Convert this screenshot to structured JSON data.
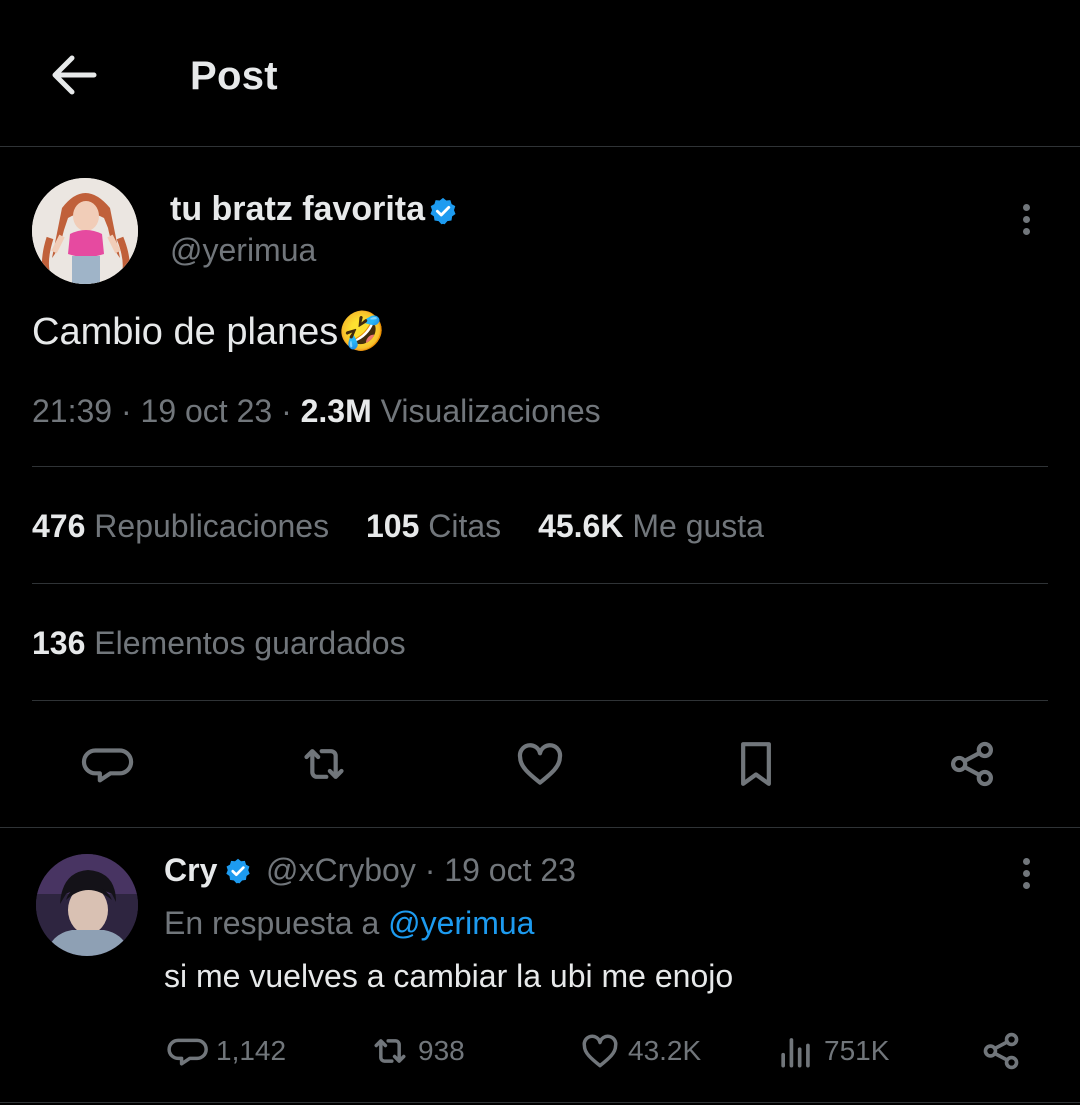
{
  "header": {
    "title": "Post"
  },
  "tweet": {
    "author_name": "tu bratz favorita",
    "author_handle": "@yerimua",
    "text": "Cambio de planes",
    "emoji": "🤣",
    "time": "21:39",
    "date": "19 oct 23",
    "views_count": "2.3M",
    "views_label": "Visualizaciones",
    "reposts_count": "476",
    "reposts_label": "Republicaciones",
    "quotes_count": "105",
    "quotes_label": "Citas",
    "likes_count": "45.6K",
    "likes_label": "Me gusta",
    "bookmarks_count": "136",
    "bookmarks_label": "Elementos guardados"
  },
  "reply": {
    "author_name": "Cry",
    "author_handle": "@xCryboy",
    "date": "· 19 oct 23",
    "context_prefix": "En respuesta a",
    "context_mention": "@yerimua",
    "text": "si me vuelves a cambiar la ubi me enojo",
    "replies": "1,142",
    "reposts": "938",
    "likes": "43.2K",
    "views": "751K"
  },
  "colors": {
    "background": "#000000",
    "text": "#e7e9ea",
    "secondary": "#71767b",
    "accent": "#1d9bf0",
    "verified": "#1d9bf0",
    "divider": "#2f3336"
  },
  "icons": [
    "arrow-left-icon",
    "verified-badge-icon",
    "more-vertical-icon",
    "reply-icon",
    "repost-icon",
    "heart-icon",
    "bookmark-icon",
    "share-icon",
    "views-icon"
  ]
}
